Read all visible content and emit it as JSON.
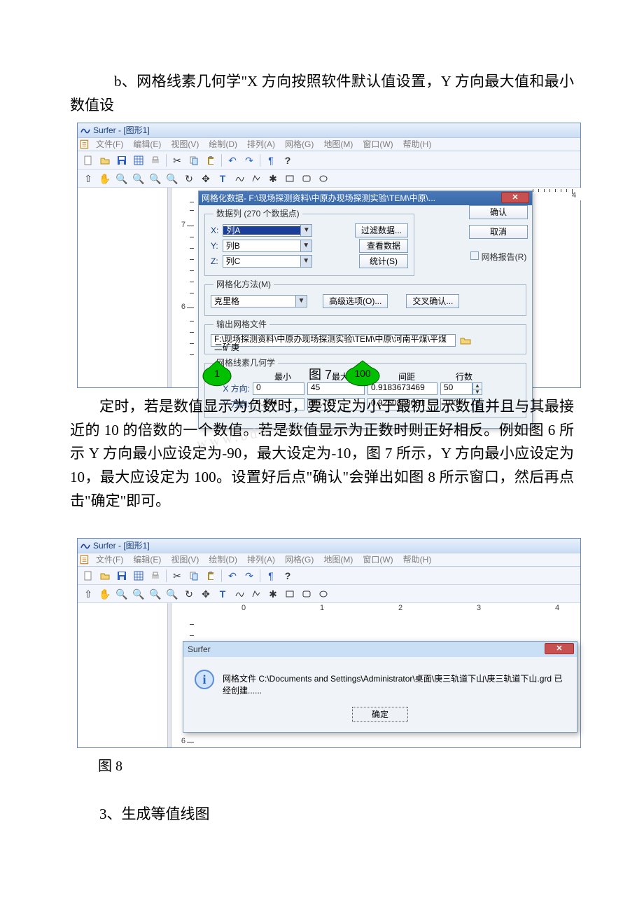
{
  "doc": {
    "para_b": "b、网格线素几何学\"X 方向按照软件默认值设置，Y 方向最大值和最小数值设",
    "para_mid": "定时，若是数值显示为负数时，要设定为小于最初显示数值并且与其最接近的 10 的倍数的一个数值。若是数值显示为正数时则正好相反。例如图 6 所示 Y 方向最小应设定为-90，最大设定为-10，图 7 所示，Y 方向最小应设定为 10，最大应设定为 100。设置好后点\"确认\"会弹出如图 8 所示窗口，然后再点击\"确定\"即可。",
    "fig7_caption": "图 7",
    "fig8_caption": "图 8",
    "section3": "3、生成等值线图"
  },
  "win": {
    "title": "Surfer - [图形1]",
    "menus": [
      "文件(F)",
      "编辑(E)",
      "视图(V)",
      "绘制(D)",
      "排列(A)",
      "网格(G)",
      "地图(M)",
      "窗口(W)",
      "帮助(H)"
    ]
  },
  "dlg": {
    "title": "网格化数据- F:\\现场探测资料\\中原办现场探测实验\\TEM\\中原\\...",
    "grp_data": "数据列    (270 个数据点)",
    "xlabel": "X:",
    "ylabel": "Y:",
    "zlabel": "Z:",
    "colA": "列A",
    "colB": "列B",
    "colC": "列C",
    "btn_filter": "过滤数据...",
    "btn_view": "查看数据",
    "btn_stat": "统计(S)",
    "btn_ok": "确认",
    "btn_cancel": "取消",
    "chk_report": "网格报告(R)",
    "grp_method": "网格化方法(M)",
    "method": "克里格",
    "btn_adv": "高级选项(O)...",
    "btn_cross": "交叉确认...",
    "grp_out": "输出网格文件",
    "out_path": "F:\\现场探测资料\\中原办现场探测实验\\TEM\\中原\\河南平煤\\平煤二矿庚",
    "grp_geom": "网格线素几何学",
    "hdr_min": "最小",
    "hdr_max": "最大",
    "hdr_step": "间距",
    "hdr_rows": "行数",
    "xdir": "X 方向:",
    "ydir": "Y 方向:",
    "xmin": "0",
    "xmax": "45",
    "xstep": "0.9183673469",
    "xrows": "50",
    "ymin": "4.174",
    "ymax": "95.757",
    "ystep": "0.9250808081",
    "yrows": "100",
    "callout_left": "1",
    "callout_right": "100"
  },
  "msg": {
    "title": "Surfer",
    "text": "网格文件  C:\\Documents and Settings\\Administrator\\桌面\\庚三轨道下山\\庚三轨道下山.grd  已经创建......",
    "ok": "确定"
  },
  "ruler": {
    "v6": "6",
    "v7": "7",
    "h4": "4",
    "h0": "0",
    "h1": "1",
    "h2": "2",
    "h3": "3"
  },
  "watermark": "www.bdo.com"
}
